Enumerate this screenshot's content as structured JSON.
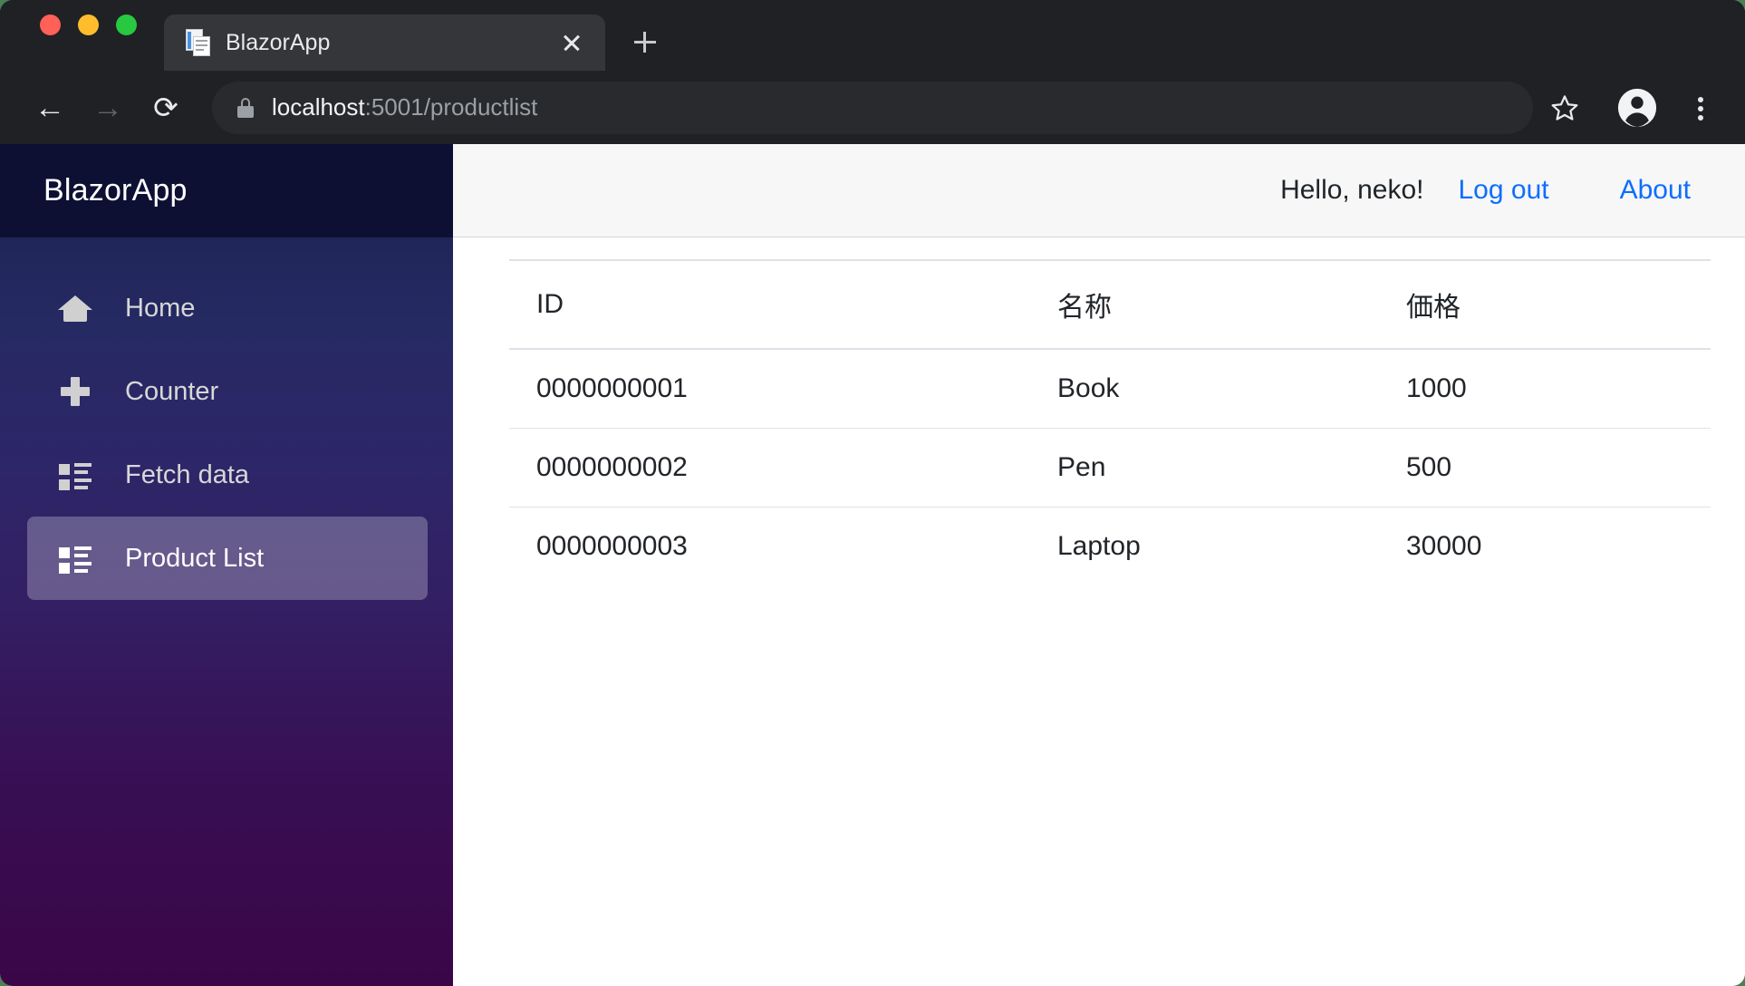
{
  "browser": {
    "traffic_lights": [
      {
        "name": "close",
        "color": "#ff6058"
      },
      {
        "name": "minimize",
        "color": "#ffbd2e"
      },
      {
        "name": "maximize",
        "color": "#28c840"
      }
    ],
    "tab": {
      "title": "BlazorApp",
      "favicon": "document-pages-icon",
      "close_icon": "close-icon"
    },
    "new_tab_icon": "plus-icon",
    "toolbar": {
      "back_icon": "arrow-left-icon",
      "back_glyph": "←",
      "forward_icon": "arrow-right-icon",
      "forward_glyph": "→",
      "reload_icon": "reload-icon",
      "reload_glyph": "⟳",
      "lock_icon": "lock-icon",
      "url_host": "localhost",
      "url_path": ":5001/productlist",
      "url_full": "localhost:5001/productlist",
      "star_icon": "star-outline-icon",
      "profile_icon": "profile-avatar-icon",
      "menu_icon": "three-dot-menu-icon"
    }
  },
  "app": {
    "brand": "BlazorApp",
    "sidebar": {
      "items": [
        {
          "label": "Home",
          "icon": "home-icon",
          "active": false
        },
        {
          "label": "Counter",
          "icon": "plus-icon",
          "active": false
        },
        {
          "label": "Fetch data",
          "icon": "list-icon",
          "active": false
        },
        {
          "label": "Product List",
          "icon": "list-icon",
          "active": true
        }
      ]
    },
    "topbar": {
      "greeting": "Hello, neko!",
      "logout_label": "Log out",
      "about_label": "About",
      "link_color": "#0d6efd"
    },
    "table": {
      "columns": [
        "ID",
        "名称",
        "価格"
      ],
      "rows": [
        {
          "id": "0000000001",
          "name": "Book",
          "price": "1000"
        },
        {
          "id": "0000000002",
          "name": "Pen",
          "price": "500"
        },
        {
          "id": "0000000003",
          "name": "Laptop",
          "price": "30000"
        }
      ]
    }
  }
}
